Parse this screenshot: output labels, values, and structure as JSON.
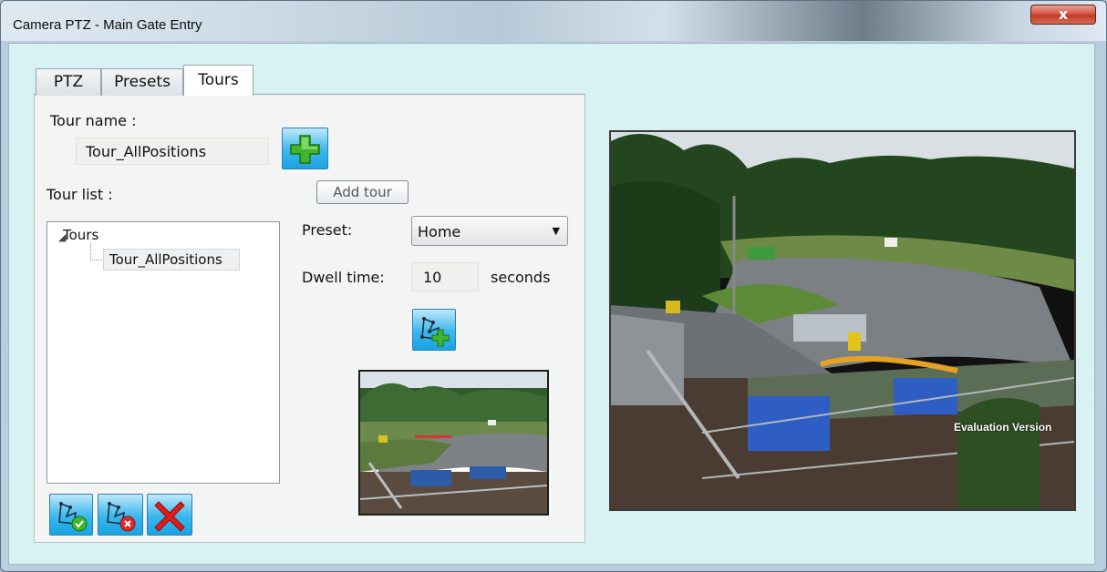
{
  "window": {
    "title": "Camera PTZ - Main Gate Entry",
    "close_glyph": "x"
  },
  "tabs": [
    {
      "label": "PTZ",
      "active": false
    },
    {
      "label": "Presets",
      "active": false
    },
    {
      "label": "Tours",
      "active": true
    }
  ],
  "tour_form": {
    "tour_name_label": "Tour name :",
    "tour_name_value": "Tour_AllPositions",
    "add_tour_tooltip": "Add tour",
    "tour_list_label": "Tour list :",
    "tree": {
      "root_label": "Tours",
      "items": [
        "Tour_AllPositions"
      ]
    },
    "preset_label": "Preset:",
    "preset_value": "Home",
    "dwell_label": "Dwell time:",
    "dwell_value": "10",
    "dwell_unit": "seconds"
  },
  "icons": {
    "add_tour": "plus-icon",
    "add_position": "tour-add-position-icon",
    "start_tour": "tour-start-icon",
    "stop_tour": "tour-stop-icon",
    "delete": "delete-x-icon"
  },
  "video": {
    "watermark": "Evaluation Version"
  },
  "colors": {
    "client_bg": "#d8f1f2",
    "button_blue": "#39b7ec",
    "close_red": "#c23a25",
    "delete_red": "#e01b1b",
    "plus_green": "#3fb62c"
  }
}
